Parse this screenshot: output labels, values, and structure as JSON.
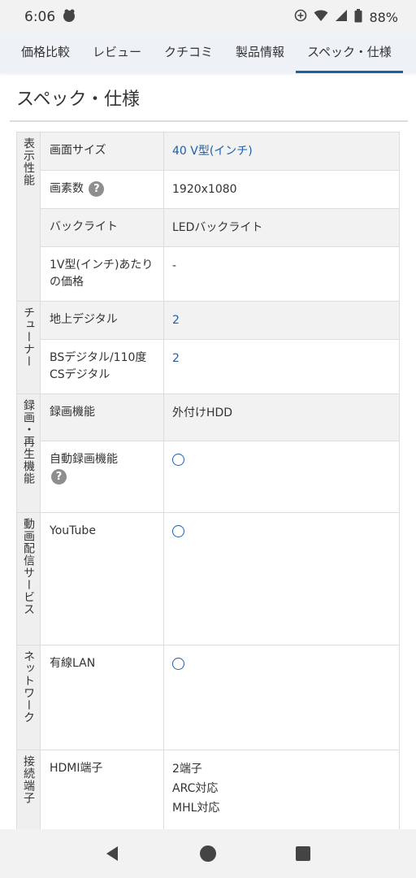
{
  "status": {
    "time": "6:06",
    "battery": "88%",
    "icons": [
      "app-notification-icon",
      "data-saver-icon",
      "wifi-icon",
      "signal-icon",
      "battery-icon"
    ]
  },
  "tabs": [
    {
      "label": "価格比較",
      "active": false
    },
    {
      "label": "レビュー",
      "active": false
    },
    {
      "label": "クチコミ",
      "active": false
    },
    {
      "label": "製品情報",
      "active": false
    },
    {
      "label": "スペック・仕様",
      "active": true
    }
  ],
  "page": {
    "title": "スペック・仕様"
  },
  "specs": {
    "display": {
      "group": "表示性能",
      "rows": [
        {
          "label": "画面サイズ",
          "value": "40 V型(インチ)"
        },
        {
          "label": "画素数",
          "value": "1920x1080"
        },
        {
          "label": "バックライト",
          "value": "LEDバックライト"
        },
        {
          "label": "1V型(インチ)あたりの価格",
          "value": "-"
        }
      ]
    },
    "tuner": {
      "group": "チューナー",
      "rows": [
        {
          "label": "地上デジタル",
          "value": "2"
        },
        {
          "label": "BSデジタル/110度CSデジタル",
          "value": "2"
        }
      ]
    },
    "recording": {
      "group": "録画・再生機能",
      "rows": [
        {
          "label": "録画機能",
          "value": "外付けHDD"
        },
        {
          "label": "自動録画機能",
          "value": "◯"
        }
      ]
    },
    "streaming": {
      "group": "動画配信サービス",
      "rows": [
        {
          "label": "YouTube",
          "value": "◯"
        }
      ]
    },
    "network": {
      "group": "ネットワーク",
      "rows": [
        {
          "label": "有線LAN",
          "value": "◯"
        }
      ]
    },
    "ports": {
      "group": "接続端子",
      "rows": [
        {
          "label": "HDMI端子",
          "value_lines": [
            "2端子",
            "ARC対応",
            "MHL対応"
          ]
        }
      ]
    }
  },
  "help_icon": "?",
  "nav": {
    "buttons": [
      "back-icon",
      "home-icon",
      "recents-icon"
    ]
  },
  "colors": {
    "accent": "#1f5fa8",
    "row_shade": "#f2f2f2"
  }
}
